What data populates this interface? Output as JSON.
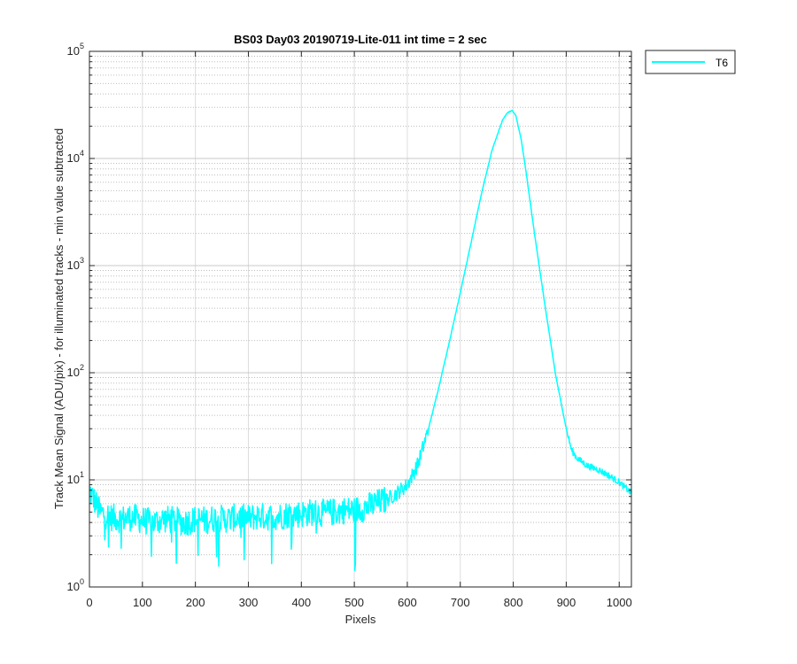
{
  "chart_data": {
    "type": "line",
    "title": "BS03 Day03 20190719-Lite-011 int time = 2 sec",
    "xlabel": "Pixels",
    "ylabel": "Track Mean Signal (ADU/pix) - for illuminated tracks - min value subtracted",
    "xlim": [
      0,
      1023
    ],
    "ylim": [
      1,
      100000
    ],
    "yscale": "log",
    "grid": "major and minor",
    "legend_position": "outside top-right",
    "x_ticks": [
      "0",
      "100",
      "200",
      "300",
      "400",
      "500",
      "600",
      "700",
      "800",
      "900",
      "1000"
    ],
    "y_ticks": [
      {
        "base": "10",
        "exp": "0"
      },
      {
        "base": "10",
        "exp": "1"
      },
      {
        "base": "10",
        "exp": "2"
      },
      {
        "base": "10",
        "exp": "3"
      },
      {
        "base": "10",
        "exp": "4"
      },
      {
        "base": "10",
        "exp": "5"
      }
    ],
    "series": [
      {
        "name": "T6",
        "color": "#00FFFF",
        "x": [
          0,
          20,
          40,
          60,
          80,
          100,
          120,
          140,
          160,
          180,
          200,
          220,
          240,
          260,
          280,
          300,
          320,
          340,
          360,
          380,
          400,
          420,
          440,
          460,
          480,
          500,
          520,
          540,
          560,
          580,
          600,
          620,
          640,
          660,
          680,
          700,
          720,
          740,
          760,
          780,
          790,
          798,
          805,
          815,
          825,
          840,
          860,
          880,
          900,
          910,
          920,
          940,
          960,
          980,
          1000,
          1023
        ],
        "y": [
          8,
          5,
          4.5,
          4.3,
          4.5,
          4.2,
          4,
          4.3,
          4.2,
          4,
          4.3,
          4.2,
          4.4,
          4.3,
          4.5,
          4.4,
          4.6,
          4.5,
          4.6,
          4.8,
          4.8,
          5,
          4.9,
          5,
          5.2,
          5.2,
          5.5,
          6,
          6.5,
          7.5,
          9,
          14,
          30,
          75,
          200,
          560,
          1600,
          4700,
          12000,
          23000,
          27000,
          28000,
          25000,
          15000,
          7000,
          2000,
          420,
          95,
          30,
          19,
          16,
          13.5,
          12.5,
          11,
          9.5,
          7.5
        ]
      }
    ]
  }
}
